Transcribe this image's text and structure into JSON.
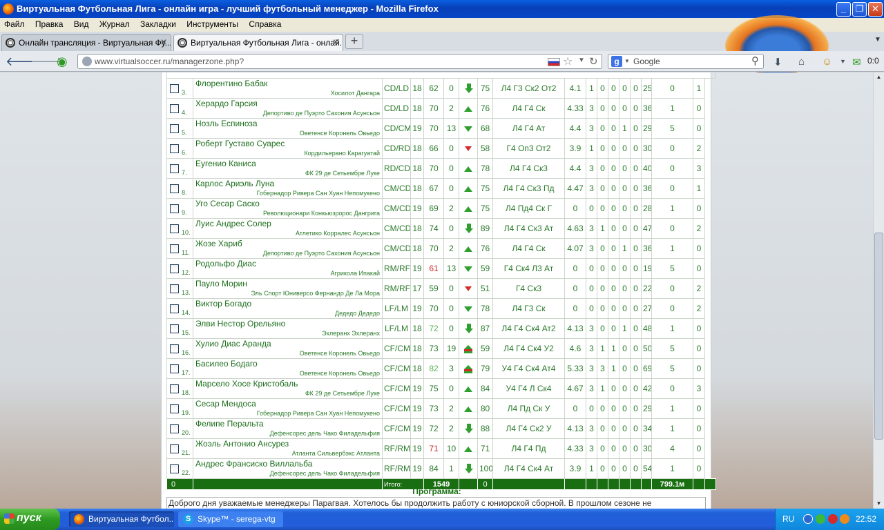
{
  "window": {
    "title": "Виртуальная Футбольная Лига - онлайн игра - лучший футбольный менеджер - Mozilla Firefox"
  },
  "menu": [
    "Файл",
    "Правка",
    "Вид",
    "Журнал",
    "Закладки",
    "Инструменты",
    "Справка"
  ],
  "tabs": [
    {
      "label": "Онлайн трансляция - Виртуальная Фу..."
    },
    {
      "label": "Виртуальная Футбольная Лига - онлай..."
    }
  ],
  "address": {
    "url": "www.virtualsoccer.ru/managerzone.php?"
  },
  "search": {
    "placeholder": "Google"
  },
  "toolbar": {
    "counter": "0:0"
  },
  "players": [
    {
      "n": "3.",
      "name": "Флорентино Бабак",
      "club": "Хосилот Дангара",
      "pos": "CD/LD",
      "age": "18",
      "str": "62",
      "s2": "0",
      "arrow": "big",
      "val": "75",
      "skills": "Л4 Г3 Ск2 От2",
      "r": "4.1",
      "a": "1",
      "b": "0",
      "c": "0",
      "d": "0",
      "e": "0",
      "price": "25 805к",
      "f": "0",
      "g": "1"
    },
    {
      "n": "4.",
      "name": "Херардо Гарсия",
      "club": "Депортиво де Пуэрто Сахония Асунсьон",
      "pos": "CD/LD",
      "age": "18",
      "str": "70",
      "s2": "2",
      "arrow": "up",
      "val": "76",
      "skills": "Л4 Г4 Ск",
      "r": "4.33",
      "a": "3",
      "b": "0",
      "c": "0",
      "d": "0",
      "e": "0",
      "price": "36 469к",
      "f": "1",
      "g": "0"
    },
    {
      "n": "5.",
      "name": "Нозль Еспиноза",
      "club": "Оветенсе Коронель Овьедо",
      "pos": "CD/CM",
      "age": "19",
      "str": "70",
      "s2": "13",
      "arrow": "dn",
      "val": "68",
      "skills": "Л4 Г4 Ат",
      "r": "4.4",
      "a": "3",
      "b": "0",
      "c": "0",
      "d": "1",
      "e": "0",
      "price": "29 315к",
      "f": "5",
      "g": "0"
    },
    {
      "n": "6.",
      "name": "Роберт Густаво Суарес",
      "club": "Кордильерано Карагуатай",
      "pos": "CD/RD",
      "age": "18",
      "str": "66",
      "s2": "0",
      "arrow": "rd",
      "val": "58",
      "skills": "Г4 Оп3 От2",
      "r": "3.9",
      "a": "1",
      "b": "0",
      "c": "0",
      "d": "0",
      "e": "0",
      "price": "30 188к",
      "f": "0",
      "g": "2"
    },
    {
      "n": "7.",
      "name": "Еугенио Каниса",
      "club": "ФК 29 де Сетьембре Луке",
      "pos": "RD/CD",
      "age": "18",
      "str": "70",
      "s2": "0",
      "arrow": "up",
      "val": "78",
      "skills": "Л4 Г4 Ск3",
      "r": "4.4",
      "a": "3",
      "b": "0",
      "c": "0",
      "d": "0",
      "e": "0",
      "price": "40 032к",
      "f": "0",
      "g": "3"
    },
    {
      "n": "8.",
      "name": "Карлос Ариэль Луна",
      "club": "Гобернадор Ривера Сан Хуан Непомукено",
      "pos": "CM/CD",
      "age": "18",
      "str": "67",
      "s2": "0",
      "arrow": "up",
      "val": "75",
      "skills": "Л4 Г4 Ск3 Пд",
      "r": "4.47",
      "a": "3",
      "b": "0",
      "c": "0",
      "d": "0",
      "e": "0",
      "price": "36 421к",
      "f": "0",
      "g": "1"
    },
    {
      "n": "9.",
      "name": "Уго Сесар Саско",
      "club": "Революционари Конкьюзророс Дангрига",
      "pos": "CM/CD",
      "age": "19",
      "str": "69",
      "s2": "2",
      "arrow": "up",
      "val": "75",
      "skills": "Л4 Пд4 Ск Г",
      "r": "0",
      "a": "0",
      "b": "0",
      "c": "0",
      "d": "0",
      "e": "0",
      "price": "28 947к",
      "f": "1",
      "g": "0"
    },
    {
      "n": "10.",
      "name": "Луис Андрес Солер",
      "club": "Атлетико Корралес Асунсьон",
      "pos": "CM/CD",
      "age": "18",
      "str": "74",
      "s2": "0",
      "arrow": "big",
      "val": "89",
      "skills": "Л4 Г4 Ск3 Ат",
      "r": "4.63",
      "a": "3",
      "b": "1",
      "c": "0",
      "d": "0",
      "e": "0",
      "price": "47 963к",
      "f": "0",
      "g": "2"
    },
    {
      "n": "11.",
      "name": "Жозе Хариб",
      "club": "Депортиво де Пуэрто Сахония Асунсьон",
      "pos": "CM/CD",
      "age": "18",
      "str": "70",
      "s2": "2",
      "arrow": "up",
      "val": "76",
      "skills": "Л4 Г4 Ск",
      "r": "4.07",
      "a": "3",
      "b": "0",
      "c": "0",
      "d": "1",
      "e": "0",
      "price": "36 469к",
      "f": "1",
      "g": "0"
    },
    {
      "n": "12.",
      "name": "Родольфо Диас",
      "club": "Агрикола Ипакай",
      "pos": "RM/RF",
      "age": "19",
      "str": "61",
      "strc": "red",
      "s2": "13",
      "arrow": "dn",
      "val": "59",
      "skills": "Г4 Ск4 Л3 Ат",
      "r": "0",
      "a": "0",
      "b": "0",
      "c": "0",
      "d": "0",
      "e": "0",
      "price": "19 394к",
      "f": "5",
      "g": "0"
    },
    {
      "n": "13.",
      "name": "Пауло Морин",
      "club": "Эль Спорт Юниверсо Фернандо Де Ла Мора",
      "pos": "RM/RF",
      "age": "17",
      "str": "59",
      "s2": "0",
      "arrow": "rd",
      "val": "51",
      "skills": "Г4 Ск3",
      "r": "0",
      "a": "0",
      "b": "0",
      "c": "0",
      "d": "0",
      "e": "0",
      "price": "22 168к",
      "f": "0",
      "g": "2"
    },
    {
      "n": "14.",
      "name": "Виктор Богадо",
      "club": "Дедедо Дедедо",
      "pos": "LF/LM",
      "age": "19",
      "str": "70",
      "s2": "0",
      "arrow": "dn",
      "val": "78",
      "skills": "Л4 Г3 Ск",
      "r": "0",
      "a": "0",
      "b": "0",
      "c": "0",
      "d": "0",
      "e": "0",
      "price": "27 589к",
      "f": "0",
      "g": "2"
    },
    {
      "n": "15.",
      "name": "Элви Нестор Орельяно",
      "club": "Эхлеранх Эхлеранх",
      "pos": "LF/LM",
      "age": "18",
      "str": "72",
      "strc": "lg",
      "s2": "0",
      "arrow": "big",
      "val": "87",
      "skills": "Л4 Г4 Ск4 Ат2",
      "r": "4.13",
      "a": "3",
      "b": "0",
      "c": "0",
      "d": "1",
      "e": "0",
      "price": "48 976к",
      "f": "1",
      "g": "0"
    },
    {
      "n": "16.",
      "name": "Хулио Диас Аранда",
      "club": "Оветенсе Коронель Овьедо",
      "pos": "CF/CM",
      "age": "18",
      "str": "73",
      "s2": "19",
      "arrow": "dbl",
      "val": "59",
      "skills": "Л4 Г4 Ск4 У2",
      "r": "4.6",
      "a": "3",
      "b": "1",
      "c": "1",
      "d": "0",
      "e": "0",
      "price": "50 756к",
      "f": "5",
      "g": "0"
    },
    {
      "n": "17.",
      "name": "Басилео Бодаго",
      "club": "Оветенсе Коронель Овьедо",
      "pos": "CF/CM",
      "age": "18",
      "str": "82",
      "strc": "lg",
      "s2": "3",
      "arrow": "dbl",
      "val": "79",
      "skills": "У4 Г4 Ск4 Ат4",
      "r": "5.33",
      "a": "3",
      "b": "3",
      "c": "1",
      "d": "0",
      "e": "0",
      "price": "69 259к",
      "f": "5",
      "g": "0"
    },
    {
      "n": "18.",
      "name": "Марсело Хосе Кристобаль",
      "club": "ФК 29 де Сетьембре Луке",
      "pos": "CF/CM",
      "age": "19",
      "str": "75",
      "s2": "0",
      "arrow": "up",
      "val": "84",
      "skills": "У4 Г4 Л Ск4",
      "r": "4.67",
      "a": "3",
      "b": "1",
      "c": "0",
      "d": "0",
      "e": "0",
      "price": "42 355к",
      "f": "0",
      "g": "3"
    },
    {
      "n": "19.",
      "name": "Сесар Мендоса",
      "club": "Гобернадор Ривера Сан Хуан Непомукено",
      "pos": "CF/CM",
      "age": "19",
      "str": "73",
      "s2": "2",
      "arrow": "up",
      "val": "80",
      "skills": "Л4 Пд Ск У",
      "r": "0",
      "a": "0",
      "b": "0",
      "c": "0",
      "d": "0",
      "e": "0",
      "price": "29 423к",
      "f": "1",
      "g": "0"
    },
    {
      "n": "20.",
      "name": "Фелипе Перальта",
      "club": "Дефенсорес дель Чако Филадельфия",
      "pos": "CF/CM",
      "age": "19",
      "str": "72",
      "s2": "2",
      "arrow": "big",
      "val": "88",
      "skills": "Л4 Г4 Ск2 У",
      "r": "4.13",
      "a": "3",
      "b": "0",
      "c": "0",
      "d": "0",
      "e": "0",
      "price": "34 667к",
      "f": "1",
      "g": "0"
    },
    {
      "n": "21.",
      "name": "Жоэль Антонио Ансурез",
      "club": "Атланта Сильвербэкс Атланта",
      "pos": "RF/RM",
      "age": "19",
      "str": "71",
      "strc": "red",
      "s2": "10",
      "arrow": "up",
      "val": "71",
      "skills": "Л4 Г4 Пд",
      "r": "4.33",
      "a": "3",
      "b": "0",
      "c": "0",
      "d": "0",
      "e": "0",
      "price": "30 712к",
      "f": "4",
      "g": "0"
    },
    {
      "n": "22.",
      "name": "Андрес Франсиско Виллальба",
      "club": "Дефенсорес дель Чако Филадельфия",
      "pos": "RF/RM",
      "age": "19",
      "str": "84",
      "s2": "1",
      "arrow": "big",
      "val": "100",
      "skills": "Л4 Г4 Ск4 Ат",
      "r": "3.9",
      "a": "1",
      "b": "0",
      "c": "0",
      "d": "0",
      "e": "0",
      "price": "54 086к",
      "f": "1",
      "g": "0"
    }
  ],
  "totals": {
    "selected": "0",
    "label": "Итого:",
    "strength": "1549",
    "value": "0",
    "price": "799.1м"
  },
  "program": {
    "title": "Программа:",
    "text": "Доброго дня уважаемые менеджеры Парагвая. Хотелось бы продолжить работу с юниорской сборной. В прошлом сезоне не"
  },
  "taskbar": {
    "start": "пуск",
    "tasks": [
      "Виртуальная Футбол...",
      "Skype™ - serega-vtg"
    ],
    "lang": "RU",
    "clock": "22:52"
  }
}
